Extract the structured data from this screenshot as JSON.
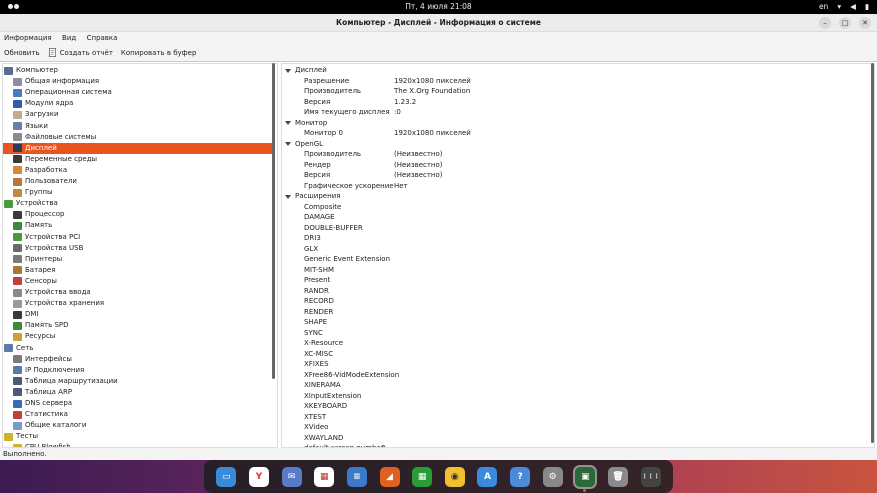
{
  "topbar": {
    "clock": "Пт, 4 июля  21:08",
    "lang": "en"
  },
  "window": {
    "title": "Компьютер - Дисплей - Информация о системе"
  },
  "menu": [
    "Информация",
    "Вид",
    "Справка"
  ],
  "toolbar": {
    "refresh": "Обновить",
    "report": "Создать отчёт",
    "copy": "Копировать в буфер"
  },
  "tree": [
    {
      "label": "Компьютер",
      "level": 0,
      "icon": "computer-icon",
      "color": "#5a6b8c"
    },
    {
      "label": "Общая информация",
      "level": 1,
      "icon": "summary-icon",
      "color": "#8b8fa3"
    },
    {
      "label": "Операционная система",
      "level": 1,
      "icon": "os-icon",
      "color": "#4a78c2"
    },
    {
      "label": "Модули ядра",
      "level": 1,
      "icon": "kernel-modules-icon",
      "color": "#2f5fa8"
    },
    {
      "label": "Загрузки",
      "level": 1,
      "icon": "boots-icon",
      "color": "#bfae8a"
    },
    {
      "label": "Языки",
      "level": 1,
      "icon": "languages-icon",
      "color": "#6b7fa8"
    },
    {
      "label": "Файловые системы",
      "level": 1,
      "icon": "filesystems-icon",
      "color": "#8b8b8b"
    },
    {
      "label": "Дисплей",
      "level": 1,
      "icon": "display-icon",
      "color": "#2a3b5c",
      "selected": true
    },
    {
      "label": "Переменные среды",
      "level": 1,
      "icon": "environment-icon",
      "color": "#3a3a3a"
    },
    {
      "label": "Разработка",
      "level": 1,
      "icon": "development-icon",
      "color": "#d08c3a"
    },
    {
      "label": "Пользователи",
      "level": 1,
      "icon": "users-icon",
      "color": "#b8743a"
    },
    {
      "label": "Группы",
      "level": 1,
      "icon": "groups-icon",
      "color": "#c08a40"
    },
    {
      "label": "Устройства",
      "level": 0,
      "icon": "devices-icon",
      "color": "#4a9a3a"
    },
    {
      "label": "Процессор",
      "level": 1,
      "icon": "processor-icon",
      "color": "#3a3a3a"
    },
    {
      "label": "Память",
      "level": 1,
      "icon": "memory-icon",
      "color": "#3a8a3a"
    },
    {
      "label": "Устройства PCI",
      "level": 1,
      "icon": "pci-icon",
      "color": "#4a9a3a"
    },
    {
      "label": "Устройства USB",
      "level": 1,
      "icon": "usb-icon",
      "color": "#6a6a6a"
    },
    {
      "label": "Принтеры",
      "level": 1,
      "icon": "printer-icon",
      "color": "#7a7a7a"
    },
    {
      "label": "Батарея",
      "level": 1,
      "icon": "battery-icon",
      "color": "#a87a2a"
    },
    {
      "label": "Сенсоры",
      "level": 1,
      "icon": "sensors-icon",
      "color": "#c04040"
    },
    {
      "label": "Устройства ввода",
      "level": 1,
      "icon": "input-devices-icon",
      "color": "#8a8a8a"
    },
    {
      "label": "Устройства хранения",
      "level": 1,
      "icon": "storage-icon",
      "color": "#9a9a9a"
    },
    {
      "label": "DMI",
      "level": 1,
      "icon": "dmi-icon",
      "color": "#3a3a3a"
    },
    {
      "label": "Память SPD",
      "level": 1,
      "icon": "spd-icon",
      "color": "#3a8a3a"
    },
    {
      "label": "Ресурсы",
      "level": 1,
      "icon": "resources-icon",
      "color": "#d0a030"
    },
    {
      "label": "Сеть",
      "level": 0,
      "icon": "network-icon",
      "color": "#5a7aa8"
    },
    {
      "label": "Интерфейсы",
      "level": 1,
      "icon": "interfaces-icon",
      "color": "#7a7a7a"
    },
    {
      "label": "IP Подключения",
      "level": 1,
      "icon": "ip-connections-icon",
      "color": "#5a7aa8"
    },
    {
      "label": "Таблица маршрутизации",
      "level": 1,
      "icon": "routing-icon",
      "color": "#4a5a7a"
    },
    {
      "label": "Таблица ARP",
      "level": 1,
      "icon": "arp-icon",
      "color": "#4a5a7a"
    },
    {
      "label": "DNS сервера",
      "level": 1,
      "icon": "dns-icon",
      "color": "#3a6ab8"
    },
    {
      "label": "Статистика",
      "level": 1,
      "icon": "statistics-icon",
      "color": "#c04040"
    },
    {
      "label": "Общие каталоги",
      "level": 1,
      "icon": "shared-dirs-icon",
      "color": "#7a9ac8"
    },
    {
      "label": "Тесты",
      "level": 0,
      "icon": "benchmarks-icon",
      "color": "#d0b030"
    },
    {
      "label": "CPU Blowfish",
      "level": 1,
      "icon": "blowfish-icon",
      "color": "#d0b030"
    }
  ],
  "details": [
    {
      "type": "section",
      "label": "Дисплей"
    },
    {
      "type": "kv",
      "key": "Разрешение",
      "value": "1920x1080 пикселей"
    },
    {
      "type": "kv",
      "key": "Производитель",
      "value": "The X.Org Foundation"
    },
    {
      "type": "kv",
      "key": "Версия",
      "value": "1.23.2"
    },
    {
      "type": "kv",
      "key": "Имя текущего дисплея",
      "value": ":0"
    },
    {
      "type": "section",
      "label": "Монитор"
    },
    {
      "type": "kv",
      "key": "Монитор 0",
      "value": "1920x1080 пикселей"
    },
    {
      "type": "section",
      "label": "OpenGL"
    },
    {
      "type": "kv",
      "key": "Производитель",
      "value": "(Неизвестно)"
    },
    {
      "type": "kv",
      "key": "Рендер",
      "value": "(Неизвестно)"
    },
    {
      "type": "kv",
      "key": "Версия",
      "value": "(Неизвестно)"
    },
    {
      "type": "kv",
      "key": "Графическое ускорение",
      "value": "Нет"
    },
    {
      "type": "section",
      "label": "Расширения"
    },
    {
      "type": "kv",
      "key": "Composite",
      "value": ""
    },
    {
      "type": "kv",
      "key": "DAMAGE",
      "value": ""
    },
    {
      "type": "kv",
      "key": "DOUBLE-BUFFER",
      "value": ""
    },
    {
      "type": "kv",
      "key": "DRI3",
      "value": ""
    },
    {
      "type": "kv",
      "key": "GLX",
      "value": ""
    },
    {
      "type": "kv",
      "key": "Generic Event Extension",
      "value": ""
    },
    {
      "type": "kv",
      "key": "MIT-SHM",
      "value": ""
    },
    {
      "type": "kv",
      "key": "Present",
      "value": ""
    },
    {
      "type": "kv",
      "key": "RANDR",
      "value": ""
    },
    {
      "type": "kv",
      "key": "RECORD",
      "value": ""
    },
    {
      "type": "kv",
      "key": "RENDER",
      "value": ""
    },
    {
      "type": "kv",
      "key": "SHAPE",
      "value": ""
    },
    {
      "type": "kv",
      "key": "SYNC",
      "value": ""
    },
    {
      "type": "kv",
      "key": "X-Resource",
      "value": ""
    },
    {
      "type": "kv",
      "key": "XC-MISC",
      "value": ""
    },
    {
      "type": "kv",
      "key": "XFIXES",
      "value": ""
    },
    {
      "type": "kv",
      "key": "XFree86-VidModeExtension",
      "value": ""
    },
    {
      "type": "kv",
      "key": "XINERAMA",
      "value": ""
    },
    {
      "type": "kv",
      "key": "XInputExtension",
      "value": ""
    },
    {
      "type": "kv",
      "key": "XKEYBOARD",
      "value": ""
    },
    {
      "type": "kv",
      "key": "XTEST",
      "value": ""
    },
    {
      "type": "kv",
      "key": "XVideo",
      "value": ""
    },
    {
      "type": "kv",
      "key": "XWAYLAND",
      "value": ""
    },
    {
      "type": "kv",
      "key": "default screen number",
      "value": "0"
    }
  ],
  "status": "Выполнено.",
  "dock": [
    {
      "name": "files-app-icon",
      "glyph": "▭",
      "color": "#3a8ad8"
    },
    {
      "name": "yandex-browser-icon",
      "glyph": "Y",
      "color": "#ffffff",
      "fg": "#e0302a"
    },
    {
      "name": "mail-app-icon",
      "glyph": "✉",
      "color": "#5a7ac8"
    },
    {
      "name": "calendar-app-icon",
      "glyph": "▦",
      "color": "#ffffff",
      "fg": "#c03030"
    },
    {
      "name": "notes-app-icon",
      "glyph": "≡",
      "color": "#3a7ac8"
    },
    {
      "name": "presentation-app-icon",
      "glyph": "◢",
      "color": "#e06020"
    },
    {
      "name": "spreadsheet-app-icon",
      "glyph": "▦",
      "color": "#2a9a3a"
    },
    {
      "name": "music-app-icon",
      "glyph": "◉",
      "color": "#f0c030",
      "fg": "#333"
    },
    {
      "name": "appstore-app-icon",
      "glyph": "A",
      "color": "#3a8ae0"
    },
    {
      "name": "help-app-icon",
      "glyph": "?",
      "color": "#4a8ad8"
    },
    {
      "name": "settings-app-icon",
      "glyph": "⚙",
      "color": "#888888"
    },
    {
      "name": "hardinfo-app-icon",
      "glyph": "▣",
      "color": "#2a6a3a",
      "active": true
    },
    {
      "name": "trash-app-icon",
      "glyph": "🗑",
      "color": "#8a8a8a"
    },
    {
      "name": "show-apps-icon",
      "glyph": "⋮⋮⋮",
      "color": "#444444"
    }
  ]
}
